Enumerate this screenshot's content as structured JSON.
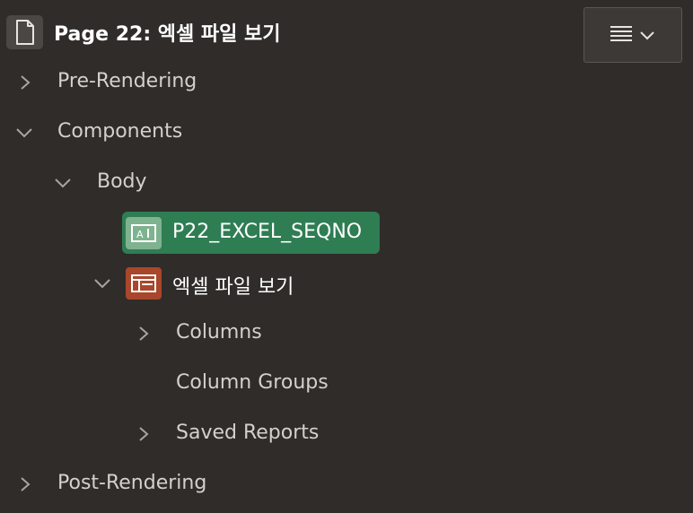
{
  "header": {
    "title": "Page 22: 엑셀 파일 보기",
    "page_icon": "page-document-icon",
    "menu_icon": "hamburger-menu-icon"
  },
  "tree": {
    "pre_rendering": "Pre-Rendering",
    "components": "Components",
    "body": "Body",
    "item_field": "P22_EXCEL_SEQNO",
    "region": "엑셀 파일 보기",
    "columns": "Columns",
    "column_groups": "Column Groups",
    "saved_reports": "Saved Reports",
    "post_rendering": "Post-Rendering"
  },
  "colors": {
    "background": "#2f2c2a",
    "selected": "#2f7d53",
    "item_icon_bg": "#7fb38f",
    "region_icon_bg": "#a8472b"
  }
}
